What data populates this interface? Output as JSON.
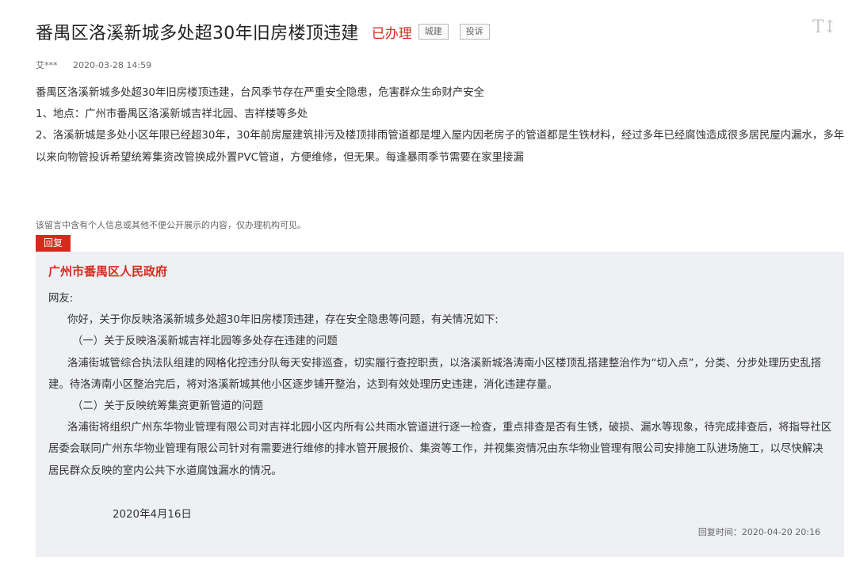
{
  "header": {
    "title": "番禺区洛溪新城多处超30年旧房楼顶违建",
    "status": "已办理",
    "tags": [
      "城建",
      "投诉"
    ],
    "font_toggle": "T↕"
  },
  "meta": {
    "author": "艾***",
    "date": "2020-03-28 14:59"
  },
  "content": {
    "line1": "番禺区洛溪新城多处超30年旧房楼顶违建，台风季节存在严重安全隐患，危害群众生命财产安全",
    "line2": "1、地点：广州市番禺区洛溪新城吉祥北园、吉祥楼等多处",
    "line3": "2、洛溪新城是多处小区年限已经超30年，30年前房屋建筑排污及楼顶排雨管道都是埋入屋内因老房子的管道都是生铁材料，经过多年已经腐蚀造成很多居民屋内漏水，多年以来向物管投诉希望统筹集资改管换成外置PVC管道，方便维修，但无果。每逢暴雨季节需要在家里接漏"
  },
  "privacy_note": "该留言中含有个人信息或其他不便公开展示的内容，仅办理机构可见。",
  "reply": {
    "badge": "回复",
    "org": "广州市番禺区人民政府",
    "greeting": "网友:",
    "p1": "你好，关于你反映洛溪新城多处超30年旧房楼顶违建，存在安全隐患等问题，有关情况如下:",
    "h1": "（一）关于反映洛溪新城吉祥北园等多处存在违建的问题",
    "p2": "洛浦街城管综合执法队组建的网格化控违分队每天安排巡查，切实履行查控职责，以洛溪新城洛涛南小区楼顶乱搭建整治作为“切入点”，分类、分步处理历史乱搭建。待洛涛南小区整治完后，将对洛溪新城其他小区逐步铺开整治，达到有效处理历史违建，消化违建存量。",
    "h2": "（二）关于反映统筹集资更新管道的问题",
    "p3": "洛浦街将组织广州东华物业管理有限公司对吉祥北园小区内所有公共雨水管道进行逐一检查，重点排查是否有生锈，破损、漏水等现象，待完成排查后，将指导社区居委会联同广州东华物业管理有限公司针对有需要进行维修的排水管开展报价、集资等工作，并视集资情况由东华物业管理有限公司安排施工队进场施工，以尽快解决居民群众反映的室内公共下水道腐蚀漏水的情况。",
    "sign_date": "2020年4月16日",
    "reply_time": "回复时间：2020-04-20 20:16"
  },
  "colors": {
    "accent": "#d52b1e",
    "reply_bg": "#eef0f3"
  }
}
